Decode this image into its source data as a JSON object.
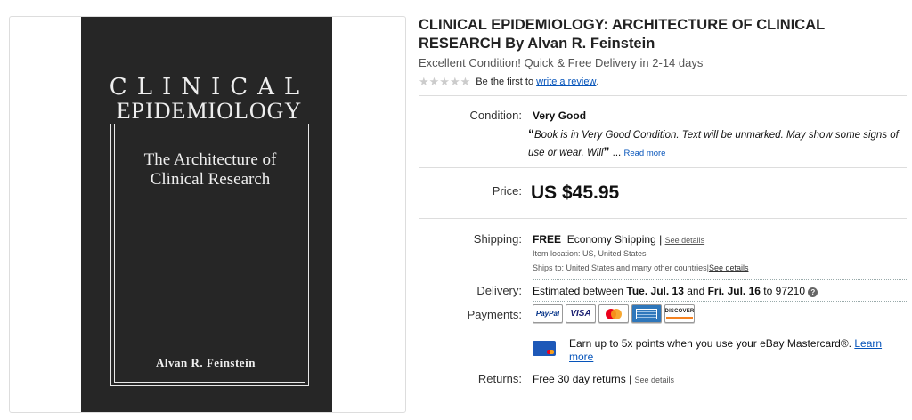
{
  "book_cover": {
    "title_line1": "CLINICAL",
    "title_line2": "EPIDEMIOLOGY",
    "subtitle": "The Architecture of Clinical Research",
    "author": "Alvan R. Feinstein"
  },
  "listing": {
    "title": "CLINICAL EPIDEMIOLOGY: ARCHITECTURE OF CLINICAL RESEARCH By Alvan R. Feinstein",
    "subtitle": "Excellent Condition! Quick & Free Delivery in 2-14 days",
    "rating_text": "Be the first to",
    "rating_link": "write a review",
    "rating_suffix": "."
  },
  "condition": {
    "label": "Condition:",
    "value": "Very Good",
    "description": "Book is in Very Good Condition.  Text will be unmarked.  May show some signs of use or wear. Will",
    "open_quote": "“",
    "close_quote": "”",
    "ellipsis": "...",
    "read_more": "Read more"
  },
  "price": {
    "label": "Price:",
    "value": "US $45.95"
  },
  "shipping": {
    "label": "Shipping:",
    "free": "FREE",
    "method": "Economy Shipping",
    "separator": "|",
    "see_details": "See details",
    "item_location": "Item location:  US, United States",
    "ships_to": "Ships to:  United States and many other countries",
    "see_details2": "See details"
  },
  "delivery": {
    "label": "Delivery:",
    "prefix": "Estimated between",
    "start": "Tue. Jul. 13",
    "and": "and",
    "end": "Fri. Jul. 16",
    "to": "to 97210",
    "help": "?"
  },
  "payments": {
    "label": "Payments:",
    "methods": [
      "PayPal",
      "VISA",
      "Mastercard",
      "AMEX",
      "DISCOVER"
    ]
  },
  "mastercard_promo": {
    "text": "Earn up to 5x points when you use your eBay Mastercard®.",
    "link": "Learn more"
  },
  "returns": {
    "label": "Returns:",
    "value": "Free 30 day returns",
    "separator": "|",
    "see_details": "See details"
  },
  "colors": {
    "link": "#0654ba",
    "cover": "#262626",
    "paypal_blue": "#003087",
    "visa_blue": "#1a1f71",
    "mc_red": "#eb001b",
    "mc_yellow": "#f79e1b",
    "amex_blue": "#2e77bb",
    "discover_orange": "#f58220"
  }
}
